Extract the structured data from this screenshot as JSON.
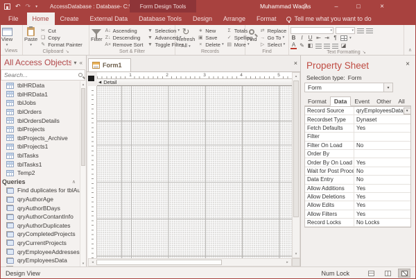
{
  "titlebar": {
    "title": "AccessDatabase : Database- C:\\Users\\Mu...",
    "contextual": "Form Design Tools",
    "user": "Muhammad Waqas",
    "help": "?",
    "minimize": "–",
    "maximize": "□",
    "close": "×"
  },
  "icons": {
    "undo": "↶",
    "redo": "↷",
    "qat_dropdown": "▾",
    "collapse_ribbon": "∧",
    "launcher": "↘",
    "nav_menu": "▾",
    "nav_shutter": "«",
    "scroll_up": "▴",
    "scroll_down": "▾",
    "scroll_left": "◂",
    "scroll_right": "▸",
    "doc_close": "×",
    "section_arrow": "◀",
    "combo_arrow": "▾",
    "builder": "…",
    "props_close": "×",
    "refresh": "↻"
  },
  "ribbon_tabs": [
    {
      "label": "File",
      "cls": "file"
    },
    {
      "label": "Home",
      "cls": "active"
    },
    {
      "label": "Create"
    },
    {
      "label": "External Data"
    },
    {
      "label": "Database Tools"
    },
    {
      "label": "Design"
    },
    {
      "label": "Arrange"
    },
    {
      "label": "Format"
    }
  ],
  "tell_me": "Tell me what you want to do",
  "ribbon": {
    "views": {
      "label": "Views",
      "view": "View"
    },
    "clipboard": {
      "label": "Clipboard",
      "paste": "Paste",
      "items": [
        {
          "label": "Cut",
          "icon": "✂"
        },
        {
          "label": "Copy",
          "icon": "❏"
        },
        {
          "label": "Format Painter",
          "icon": "✎"
        }
      ]
    },
    "sort_filter": {
      "label": "Sort & Filter",
      "filter": "Filter",
      "col1": [
        {
          "label": "Ascending",
          "icon": "A↓"
        },
        {
          "label": "Descending",
          "icon": "Z↓"
        },
        {
          "label": "Remove Sort",
          "icon": "A×"
        }
      ],
      "col2": [
        {
          "label": "Selection",
          "icon": "▼",
          "arrow": "▾"
        },
        {
          "label": "Advanced",
          "icon": "▼",
          "arrow": "▾"
        },
        {
          "label": "Toggle Filter",
          "icon": "▼"
        }
      ]
    },
    "records": {
      "label": "Records",
      "refresh_line1": "Refresh",
      "refresh_line2": "All",
      "col1": [
        {
          "label": "New",
          "icon": "∗"
        },
        {
          "label": "Save",
          "icon": "▣"
        },
        {
          "label": "Delete",
          "icon": "×",
          "arrow": "▾"
        }
      ],
      "col2": [
        {
          "label": "Totals",
          "icon": "Σ"
        },
        {
          "label": "Spelling",
          "icon": "✓"
        },
        {
          "label": "More",
          "icon": "▤",
          "arrow": "▾"
        }
      ]
    },
    "find": {
      "label": "Find",
      "find": "Find",
      "col1": [
        {
          "label": "Replace",
          "icon": "⇄"
        },
        {
          "label": "Go To",
          "icon": "→",
          "arrow": "▾"
        },
        {
          "label": "Select",
          "icon": "▷",
          "arrow": "▾"
        }
      ]
    },
    "text_formatting": {
      "label": "Text Formatting",
      "bold": "B",
      "italic": "I",
      "underline": "U",
      "font_color": "A"
    }
  },
  "nav": {
    "title": "All Access Objects",
    "search_placeholder": "Search...",
    "tables": [
      "tblHRData",
      "tblHRData1",
      "tblJobs",
      "tblOrders",
      "tblOrdersDetails",
      "tblProjects",
      "tblProjects_Archive",
      "tblProjects1",
      "tblTasks",
      "tblTasks1",
      "Temp2"
    ],
    "queries_header": "Queries",
    "queries": [
      "Find duplicates for tblAuthors",
      "qryAuthorAge",
      "qryAuthorBDays",
      "qryAuthorContantInfo",
      "qryAuthorDuplicates",
      "qryCompletedProjects",
      "qryCurrentProjects",
      "qryEmployeeAddresses",
      "qryEmployeesData"
    ]
  },
  "doc": {
    "tab": "Form1",
    "section": "Detail",
    "ruler_numbers": [
      "1",
      "2",
      "3",
      "4",
      "5"
    ]
  },
  "props": {
    "title": "Property Sheet",
    "selection_label": "Selection type:",
    "selection_value": "Form",
    "combo_value": "Form",
    "tabs": [
      {
        "label": "Format"
      },
      {
        "label": "Data",
        "cls": "active"
      },
      {
        "label": "Event"
      },
      {
        "label": "Other"
      },
      {
        "label": "All"
      }
    ],
    "rows": [
      {
        "label": "Record Source",
        "value": "qryEmployeesData",
        "cls": "has-ctl"
      },
      {
        "label": "Recordset Type",
        "value": "Dynaset"
      },
      {
        "label": "Fetch Defaults",
        "value": "Yes"
      },
      {
        "label": "Filter",
        "value": ""
      },
      {
        "label": "Filter On Load",
        "value": "No"
      },
      {
        "label": "Order By",
        "value": ""
      },
      {
        "label": "Order By On Load",
        "value": "Yes"
      },
      {
        "label": "Wait for Post Processing",
        "value": "No"
      },
      {
        "label": "Data Entry",
        "value": "No"
      },
      {
        "label": "Allow Additions",
        "value": "Yes"
      },
      {
        "label": "Allow Deletions",
        "value": "Yes"
      },
      {
        "label": "Allow Edits",
        "value": "Yes"
      },
      {
        "label": "Allow Filters",
        "value": "Yes"
      },
      {
        "label": "Record Locks",
        "value": "No Locks"
      }
    ]
  },
  "status": {
    "mode": "Design View",
    "num_lock": "Num Lock"
  }
}
